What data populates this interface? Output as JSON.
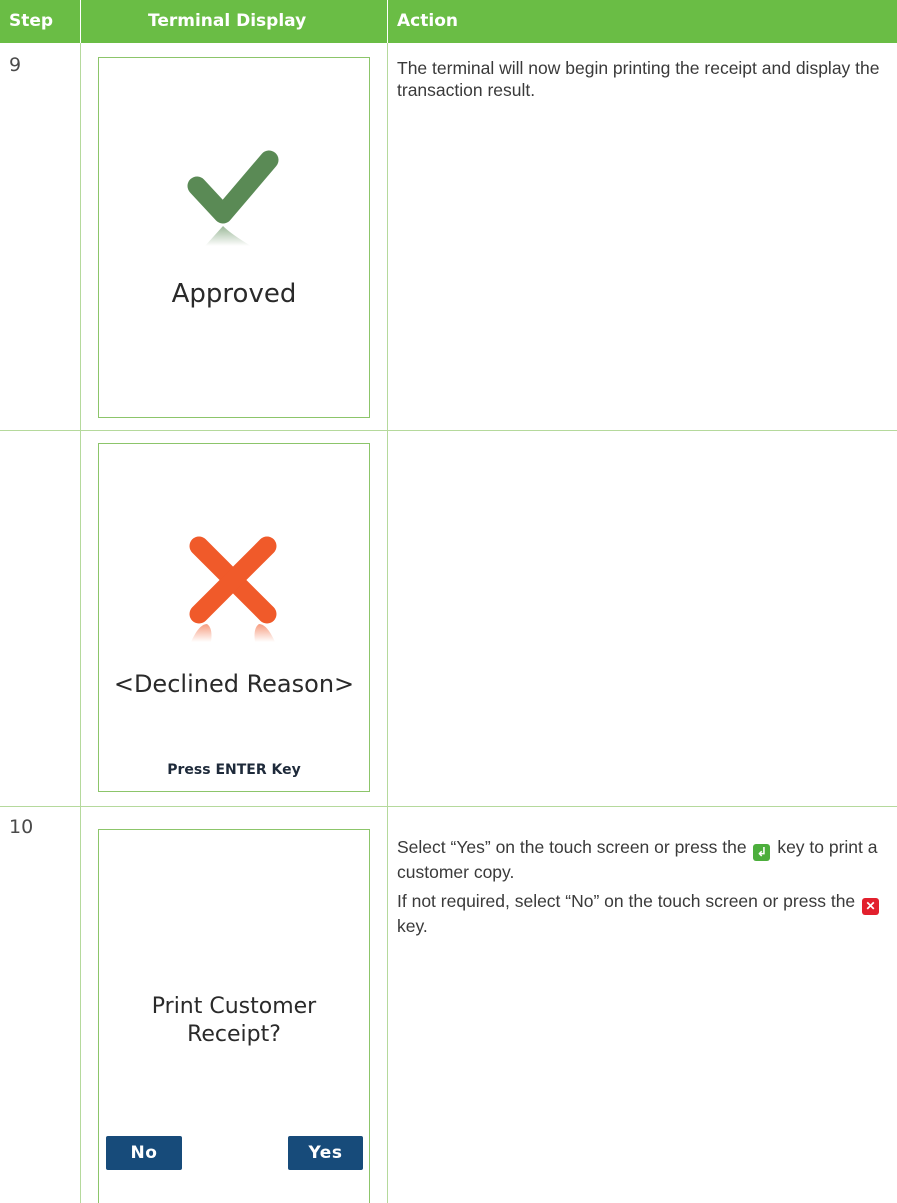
{
  "header": {
    "step": "Step",
    "display": "Terminal Display",
    "action": "Action"
  },
  "rows": [
    {
      "step": "9",
      "screen": {
        "icon": "check-icon",
        "text": "Approved"
      },
      "action": [
        "The terminal will now begin printing the receipt and display the transaction result."
      ]
    },
    {
      "step": "",
      "screen": {
        "icon": "x-icon",
        "text": "<Declined Reason>",
        "footer": "Press ENTER Key"
      },
      "action": []
    },
    {
      "step": "10",
      "screen": {
        "text_line1": "Print Customer",
        "text_line2": "Receipt?",
        "no_button": "No",
        "yes_button": "Yes"
      },
      "action": {
        "p1_before": "Select “Yes” on the touch screen or press the",
        "p1_after": "key to print a customer copy.",
        "p2_before": "If not required, select “No” on the touch screen or press the",
        "p2_after": "key."
      }
    }
  ],
  "colors": {
    "header": "#6abd45",
    "check": "#5a8a55",
    "cross": "#f05a2a",
    "button": "#174b7a",
    "enter_key": "#4cae3c",
    "cancel_key": "#e2202d"
  }
}
